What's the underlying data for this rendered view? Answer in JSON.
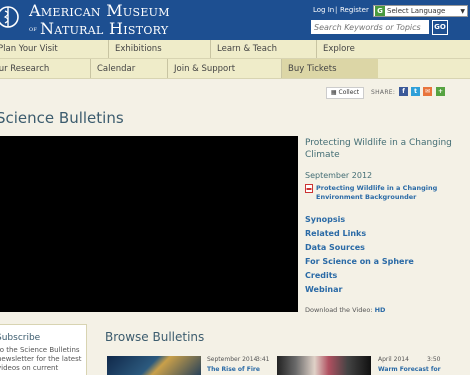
{
  "header": {
    "logo_line1": "American Museum",
    "logo_of": "of",
    "logo_line2": "Natural History",
    "login": "Log In",
    "separator": "|",
    "register": "Register",
    "language_label": "Select Language",
    "search_placeholder": "Search Keywords or Topics",
    "go_label": "GO"
  },
  "nav": {
    "row1": [
      "Plan Your Visit",
      "Exhibitions",
      "Learn & Teach",
      "Explore"
    ],
    "row2": [
      "Our Research",
      "Calendar",
      "Join & Support",
      "Buy Tickets"
    ]
  },
  "share": {
    "collect_label": "Collect",
    "share_label": "SHARE:"
  },
  "page_title": "Science Bulletins",
  "video": {
    "title": "Protecting Wildlife in a Changing Climate",
    "date": "September 2012",
    "pdf_link": "Protecting Wildlife in a Changing Environment Backgrounder",
    "links": [
      "Synopsis",
      "Related Links",
      "Data Sources",
      "For Science on a Sphere",
      "Credits",
      "Webinar"
    ],
    "download_label": "Download the Video:",
    "download_hd": "HD"
  },
  "subscribe": {
    "title": "Subscribe",
    "text": "to the Science Bulletins newsletter for the latest videos on current"
  },
  "browse": {
    "title": "Browse Bulletins",
    "items": [
      {
        "date": "September 2014",
        "duration": "3:41",
        "title": "The Rise of Fire"
      },
      {
        "date": "April 2014",
        "duration": "3:50",
        "title": "Warm Forecast for"
      }
    ]
  },
  "colors": {
    "header_blue": "#1d4f91",
    "nav_bg": "#efecc9",
    "link_blue": "#2a6aa6"
  }
}
